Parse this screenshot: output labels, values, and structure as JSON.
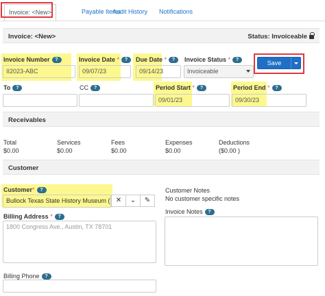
{
  "tabs": [
    {
      "label": "Invoice: <New>"
    },
    {
      "label": "Payable Items"
    },
    {
      "label": "Audit History"
    },
    {
      "label": "Notifications"
    }
  ],
  "header": {
    "title": "Invoice: <New>",
    "status": "Status: Invoiceable"
  },
  "help_glyph": "?",
  "required_marker": "*",
  "form": {
    "invoice_number": {
      "label": "Invoice Number",
      "value": "II2023-ABC"
    },
    "invoice_date": {
      "label": "Invoice Date",
      "value": "09/07/23"
    },
    "due_date": {
      "label": "Due Date",
      "value": "09/14/23"
    },
    "invoice_status": {
      "label": "Invoice Status",
      "value": "Invoiceable"
    },
    "save_label": "Save",
    "to": {
      "label": "To",
      "value": ""
    },
    "cc": {
      "label": "CC",
      "value": ""
    },
    "period_start": {
      "label": "Period Start",
      "value": "09/01/23"
    },
    "period_end": {
      "label": "Period End",
      "value": "09/30/23"
    }
  },
  "receivables": {
    "title": "Receivables",
    "items": [
      {
        "label": "Total",
        "value": "$0.00"
      },
      {
        "label": "Services",
        "value": "$0.00"
      },
      {
        "label": "Fees",
        "value": "$0.00"
      },
      {
        "label": "Expenses",
        "value": "$0.00"
      },
      {
        "label": "Deductions",
        "value": "($0.00 )"
      }
    ]
  },
  "customer": {
    "title": "Customer",
    "customer_label": "Customer",
    "customer_value": "Bullock Texas State History Museum (T",
    "billing_address_label": "Billing Address",
    "billing_address_placeholder": "1800 Congress Ave., Austin, TX 78701",
    "billing_phone_label": "Billing Phone",
    "customer_notes_label": "Customer Notes",
    "customer_notes_value": "No customer specific notes",
    "invoice_notes_label": "Invoice Notes"
  },
  "colors": {
    "highlight": "#fbf66a",
    "annotation": "#e0383e",
    "primary": "#1f6fc5"
  },
  "icons": [
    "help-icon",
    "lock-icon",
    "close-icon",
    "chevron-down-icon",
    "edit-icon"
  ]
}
